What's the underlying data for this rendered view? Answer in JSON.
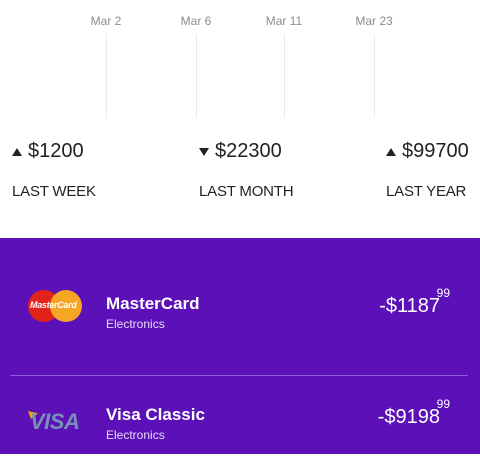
{
  "timeline": {
    "dates": [
      "Mar 2",
      "Mar 6",
      "Mar 11",
      "Mar 23"
    ]
  },
  "stats": [
    {
      "amount": "$1200",
      "label": "LAST WEEK",
      "trend": "up"
    },
    {
      "amount": "$22300",
      "label": "LAST MONTH",
      "trend": "down"
    },
    {
      "amount": "$99700",
      "label": "LAST YEAR",
      "trend": "up"
    }
  ],
  "transactions": [
    {
      "name": "MasterCard",
      "category": "Electronics",
      "amount": "-$1187",
      "cents": "99",
      "logo_text": "MasterCard",
      "icon": "mastercard-logo"
    },
    {
      "name": "Visa Classic",
      "category": "Electronics",
      "amount": "-$9198",
      "cents": "99",
      "logo_text": "VISA",
      "icon": "visa-logo"
    }
  ],
  "colors": {
    "panel": "#5b10b8",
    "text_dark": "#222222",
    "date_text": "#8d8d8d"
  }
}
